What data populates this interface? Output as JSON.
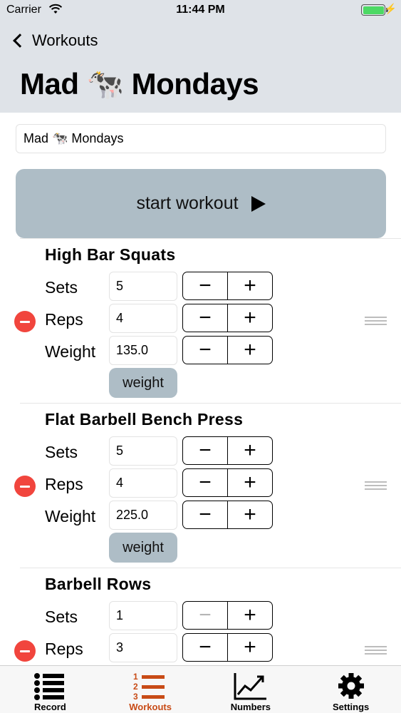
{
  "status_bar": {
    "carrier": "Carrier",
    "time": "11:44 PM"
  },
  "nav": {
    "back_label": "Workouts",
    "title": "Mad 🐄 Mondays"
  },
  "workout": {
    "name_value": "Mad 🐄 Mondays",
    "start_label": "start workout"
  },
  "exercises": [
    {
      "title": "High Bar Squats",
      "sets_label": "Sets",
      "sets_value": "5",
      "reps_label": "Reps",
      "reps_value": "4",
      "weight_label": "Weight",
      "weight_value": "135.0",
      "weight_button": "weight"
    },
    {
      "title": "Flat Barbell Bench Press",
      "sets_label": "Sets",
      "sets_value": "5",
      "reps_label": "Reps",
      "reps_value": "4",
      "weight_label": "Weight",
      "weight_value": "225.0",
      "weight_button": "weight"
    },
    {
      "title": "Barbell Rows",
      "sets_label": "Sets",
      "sets_value": "1",
      "reps_label": "Reps",
      "reps_value": "3"
    }
  ],
  "stepper": {
    "minus": "−",
    "plus": "+"
  },
  "tabs": [
    {
      "label": "Record",
      "icon": "list-icon"
    },
    {
      "label": "Workouts",
      "icon": "numbered-list-icon",
      "active": true
    },
    {
      "label": "Numbers",
      "icon": "line-chart-icon"
    },
    {
      "label": "Settings",
      "icon": "gear-icon"
    }
  ],
  "colors": {
    "accent": "#c84b16",
    "button_bg": "#aebdc6",
    "header_bg": "#dfe3e8",
    "delete": "#f1453d"
  }
}
